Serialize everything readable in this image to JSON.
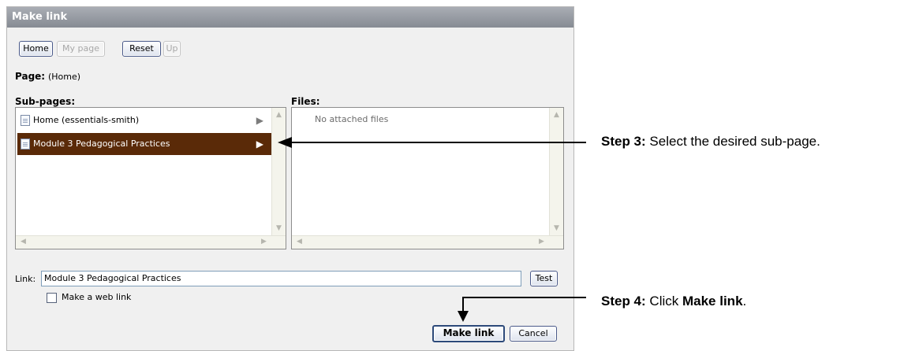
{
  "dialog": {
    "title": "Make link",
    "toolbar": {
      "home": "Home",
      "my_page": "My page",
      "reset": "Reset",
      "up": "Up"
    },
    "page_label": "Page:",
    "page_value": "(Home)",
    "subpages_label": "Sub-pages:",
    "files_label": "Files:",
    "subpages": [
      {
        "label": "Home (essentials-smith)",
        "selected": false
      },
      {
        "label": "Module 3 Pedagogical Practices",
        "selected": true
      }
    ],
    "files_empty": "No attached files",
    "link_label": "Link:",
    "link_value": "Module 3 Pedagogical Practices",
    "test_button": "Test",
    "web_link_label": "Make a web link",
    "make_link_button": "Make link",
    "cancel_button": "Cancel"
  },
  "annotations": {
    "step3_prefix": "Step 3:",
    "step3_text": "Select the desired sub-page.",
    "step4_prefix": "Step 4:",
    "step4_text_a": "Click ",
    "step4_bold": "Make link",
    "step4_text_b": "."
  },
  "colors": {
    "selected_row": "#5a2a08",
    "title_bar": "#8e939b"
  }
}
